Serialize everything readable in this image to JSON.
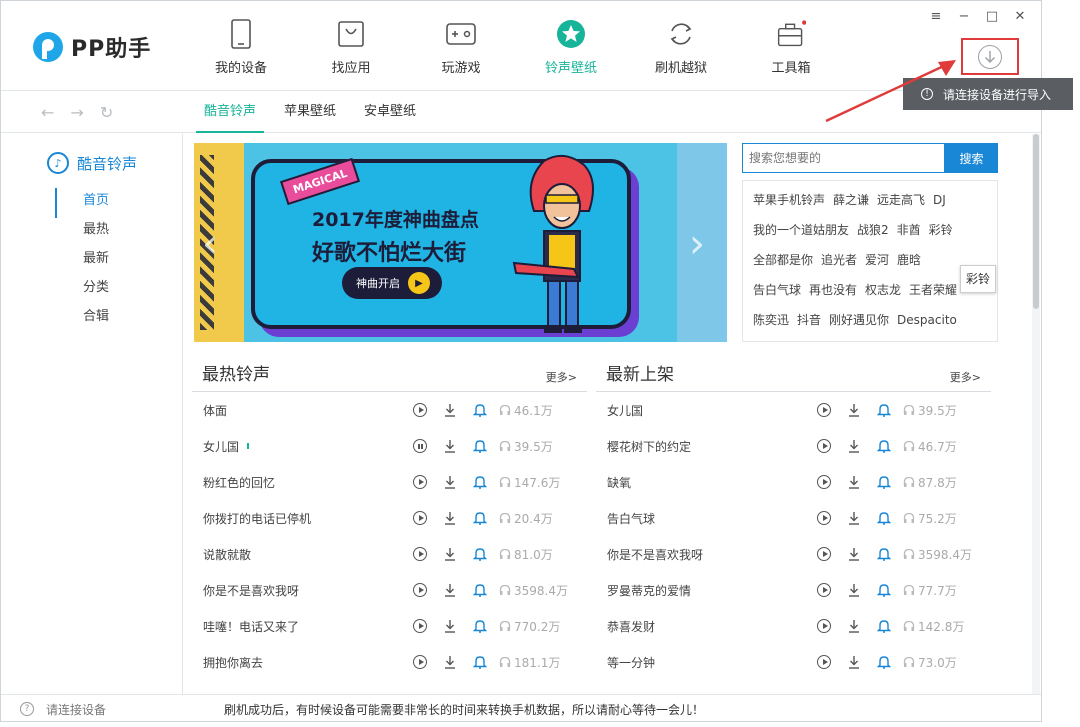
{
  "app": {
    "logo_text": "PP助手"
  },
  "nav": [
    {
      "label": "我的设备",
      "icon": "phone-icon"
    },
    {
      "label": "找应用",
      "icon": "bag-icon"
    },
    {
      "label": "玩游戏",
      "icon": "gamepad-icon"
    },
    {
      "label": "铃声壁纸",
      "icon": "star-icon"
    },
    {
      "label": "刷机越狱",
      "icon": "refresh-icon"
    },
    {
      "label": "工具箱",
      "icon": "toolbox-icon"
    }
  ],
  "window_controls": {
    "menu": "≡",
    "minimize": "−",
    "maximize": "□",
    "close": "✕"
  },
  "tooltip": {
    "text": "请连接设备进行导入"
  },
  "subtabs": [
    "酷音铃声",
    "苹果壁纸",
    "安卓壁纸"
  ],
  "sidebar": {
    "title": "酷音铃声",
    "items": [
      "首页",
      "最热",
      "最新",
      "分类",
      "合辑"
    ]
  },
  "banner": {
    "badge": "MAGICAL",
    "title1": "2017年度神曲盘点",
    "title2": "好歌不怕烂大街",
    "button": "神曲开启"
  },
  "search": {
    "placeholder": "搜索您想要的",
    "button": "搜索"
  },
  "tags": [
    [
      "苹果手机铃声",
      "薛之谦",
      "远走高飞",
      "DJ"
    ],
    [
      "我的一个道姑朋友",
      "战狼2",
      "非酋",
      "彩铃"
    ],
    [
      "全部都是你",
      "追光者",
      "爱河",
      "鹿晗"
    ],
    [
      "告白气球",
      "再也没有",
      "权志龙",
      "王者荣耀"
    ],
    [
      "陈奕迅",
      "抖音",
      "刚好遇见你",
      "Despacito"
    ]
  ],
  "tag_hover": "彩铃",
  "hot": {
    "title": "最热铃声",
    "more": "更多>",
    "songs": [
      {
        "name": "体面",
        "count": "46.1万"
      },
      {
        "name": "女儿国",
        "count": "39.5万",
        "playing": true
      },
      {
        "name": "粉红色的回忆",
        "count": "147.6万"
      },
      {
        "name": "你拨打的电话已停机",
        "count": "20.4万"
      },
      {
        "name": "说散就散",
        "count": "81.0万"
      },
      {
        "name": "你是不是喜欢我呀",
        "count": "3598.4万"
      },
      {
        "name": "哇噻！电话又来了",
        "count": "770.2万"
      },
      {
        "name": "拥抱你离去",
        "count": "181.1万"
      }
    ]
  },
  "new": {
    "title": "最新上架",
    "more": "更多>",
    "songs": [
      {
        "name": "女儿国",
        "count": "39.5万"
      },
      {
        "name": "樱花树下的约定",
        "count": "46.7万"
      },
      {
        "name": "缺氧",
        "count": "87.8万"
      },
      {
        "name": "告白气球",
        "count": "75.2万"
      },
      {
        "name": "你是不是喜欢我呀",
        "count": "3598.4万"
      },
      {
        "name": "罗曼蒂克的爱情",
        "count": "77.7万"
      },
      {
        "name": "恭喜发财",
        "count": "142.8万"
      },
      {
        "name": "等一分钟",
        "count": "73.0万"
      }
    ]
  },
  "status": {
    "device": "请连接设备",
    "message": "刷机成功后，有时候设备可能需要非常长的时间来转换手机数据，所以请耐心等待一会儿！"
  },
  "colors": {
    "accent_green": "#17b49a",
    "accent_blue": "#1a87d6",
    "highlight_red": "#e03a3a"
  }
}
